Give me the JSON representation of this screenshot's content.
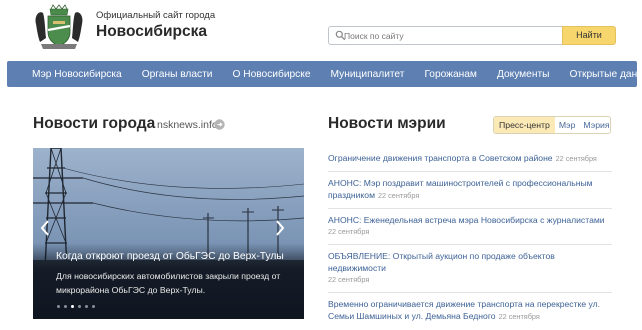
{
  "header": {
    "crest_icon": "novosibirsk-coat-of-arms",
    "subtitle": "Официальный сайт города",
    "city": "Новосибирска"
  },
  "search": {
    "placeholder": "Поиск по сайту",
    "value": "",
    "button_label": "Найти",
    "icon": "search-icon"
  },
  "nav": {
    "items": [
      {
        "label": "Мэр Новосибирска"
      },
      {
        "label": "Органы власти"
      },
      {
        "label": "О Новосибирске"
      },
      {
        "label": "Муниципалитет"
      },
      {
        "label": "Горожанам"
      },
      {
        "label": "Документы"
      },
      {
        "label": "Открытые данные"
      }
    ]
  },
  "city_news": {
    "title": "Новости города",
    "source_label": "nsknews.info",
    "source_icon": "external-link-icon",
    "slide": {
      "headline": "Когда откроют проезд от ОбьГЭС до Верх-Тулы",
      "text": "Для новосибирских автомобилистов закрыли проезд от микрорайона ОбьГЭС до Верх-Тулы.",
      "dots_total": 6,
      "dots_active": 3
    }
  },
  "mayor_news": {
    "title": "Новости мэрии",
    "tabs": [
      {
        "label": "Пресс-центр",
        "active": true
      },
      {
        "label": "Мэр",
        "active": false
      },
      {
        "label": "Мэрия",
        "active": false
      }
    ],
    "items": [
      {
        "text": "Ограничение движения транспорта в Советском районе",
        "date": "22 сентября"
      },
      {
        "text": "АНОНС: Мэр поздравит машиностроителей с профессиональным праздником",
        "date": "22 сентября"
      },
      {
        "text": "АНОНС: Еженедельная встреча мэра Новосибирска с журналистами",
        "date": "22 сентября"
      },
      {
        "text": "ОБЪЯВЛЕНИЕ: Открытый аукцион по продаже объектов недвижимости",
        "date": "22 сентября"
      },
      {
        "text": "Временно ограничивается движение транспорта на перекрестке ул. Семьи Шамшиных и ул. Демьяна Бедного",
        "date": "22 сентября"
      }
    ]
  },
  "colors": {
    "nav_bg": "#5d7fb1",
    "search_button": "#f7d66e",
    "link": "#3d6296",
    "active_tab": "#fbe9b6"
  }
}
